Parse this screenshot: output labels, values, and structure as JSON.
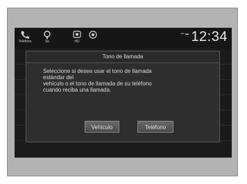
{
  "status_bar": {
    "phone_label": "Teléfono",
    "audio_label": "Se",
    "hd_label": "HD",
    "time": "12:34",
    "signal_text": "••• ▬"
  },
  "dialog": {
    "title": "Tono de llamada",
    "body_lines": [
      "Seleccione si desea usar el tono de llamada",
      "estándar del",
      "vehículo o el tono de llamada de su teléfono",
      "cuando reciba una llamada."
    ],
    "buttons": {
      "vehicle": "Vehículo",
      "phone": "Teléfono"
    }
  },
  "icons": {
    "phone": "phone-icon",
    "audio": "voice-icon",
    "hd": "hd-radio-icon",
    "settings": "circle-icon"
  },
  "colors": {
    "screen_bg": "#1b1b1b",
    "dialog_bg": "#2e2e2e",
    "text": "#dcdcdc"
  }
}
